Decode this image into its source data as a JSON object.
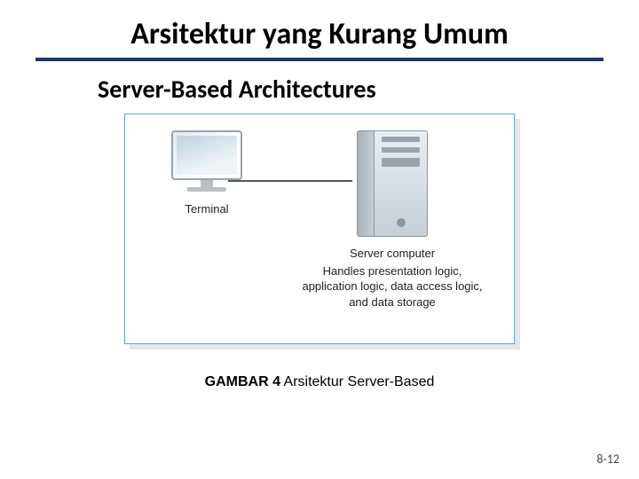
{
  "title": "Arsitektur yang Kurang Umum",
  "subtitle": "Server-Based Architectures",
  "diagram": {
    "terminal_label": "Terminal",
    "server_lead": "Server computer",
    "server_desc": "Handles presentation logic, application logic, data access logic, and data storage"
  },
  "caption_bold": "GAMBAR 4",
  "caption_rest": " Arsitektur Server-Based",
  "page_number": "8-12"
}
